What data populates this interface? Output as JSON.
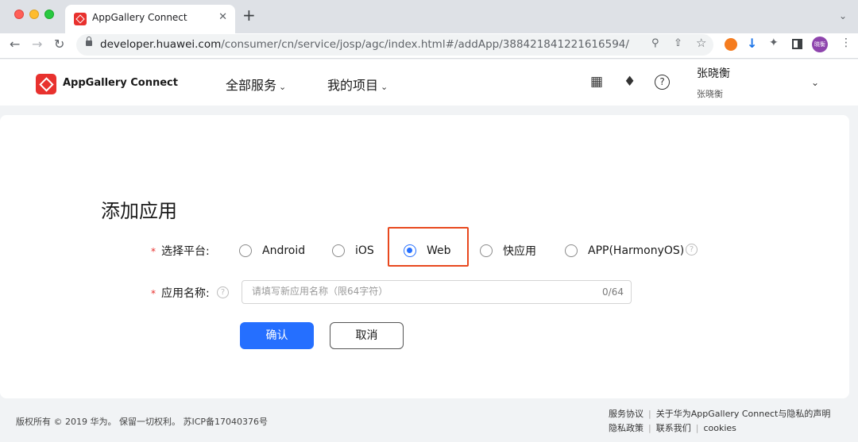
{
  "browser": {
    "tab_title": "AppGallery Connect",
    "tab_close": "✕",
    "new_tab": "+",
    "url_host": "developer.huawei.com",
    "url_path": "/consumer/cn/service/josp/agc/index.html#/addApp/388421841221616594/",
    "profile_initials": "晓衡",
    "icons": [
      "back-icon",
      "forward-icon",
      "reload-icon",
      "lock-icon",
      "zoom-icon",
      "share-icon",
      "star-icon",
      "puzzle-icon",
      "sidebar-icon",
      "kebab-menu-icon"
    ]
  },
  "header": {
    "logo_text": "AppGallery Connect",
    "nav": [
      {
        "label": "全部服务"
      },
      {
        "label": "我的项目"
      }
    ],
    "user_name": "张晓衡",
    "user_sub": "张晓衡"
  },
  "form": {
    "title": "添加应用",
    "platform_label": "选择平台:",
    "platforms": [
      {
        "label": "Android",
        "checked": false
      },
      {
        "label": "iOS",
        "checked": false
      },
      {
        "label": "Web",
        "checked": true
      },
      {
        "label": "快应用",
        "checked": false
      },
      {
        "label": "APP(HarmonyOS)",
        "checked": false
      }
    ],
    "name_label": "应用名称:",
    "name_placeholder": "请填写新应用名称（限64字符）",
    "name_value": "",
    "name_counter": "0/64",
    "confirm_label": "确认",
    "cancel_label": "取消",
    "accent_color": "#256fff",
    "highlight_color": "#e8481e"
  },
  "footer": {
    "copyright": "版权所有 © 2019 华为。 保留一切权利。 苏ICP备17040376号",
    "links_row1": [
      "服务协议",
      "关于华为AppGallery Connect与隐私的声明"
    ],
    "links_row2": [
      "隐私政策",
      "联系我们",
      "cookies"
    ]
  }
}
